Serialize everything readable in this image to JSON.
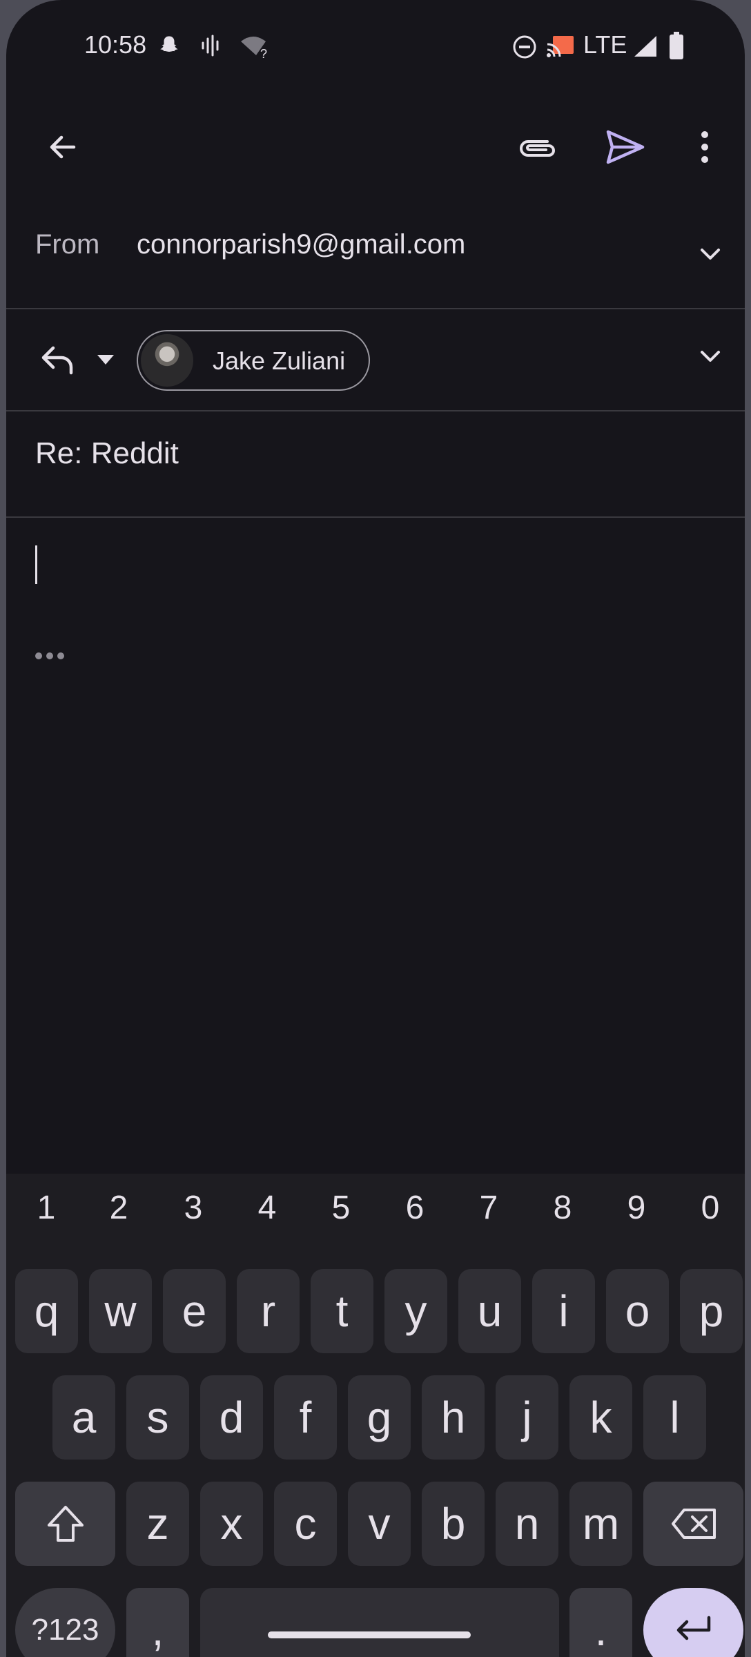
{
  "status_bar": {
    "time": "10:58",
    "network": "LTE",
    "icons": [
      "snapchat-icon",
      "voice-icon",
      "wifi-question-icon",
      "dnd-icon",
      "cast-icon",
      "signal-icon",
      "battery-icon"
    ]
  },
  "app_bar": {
    "icons": [
      "back-arrow-icon",
      "attach-icon",
      "send-icon",
      "more-vert-icon"
    ],
    "send_color": "#c0b1f2"
  },
  "compose": {
    "from_label": "From",
    "from_value": "connorparish9@gmail.com",
    "to_chip_name": "Jake Zuliani",
    "subject": "Re: Reddit"
  },
  "keyboard": {
    "numbers": [
      "1",
      "2",
      "3",
      "4",
      "5",
      "6",
      "7",
      "8",
      "9",
      "0"
    ],
    "row1": [
      "q",
      "w",
      "e",
      "r",
      "t",
      "y",
      "u",
      "i",
      "o",
      "p"
    ],
    "row2": [
      "a",
      "s",
      "d",
      "f",
      "g",
      "h",
      "j",
      "k",
      "l"
    ],
    "row3": [
      "z",
      "x",
      "c",
      "v",
      "b",
      "n",
      "m"
    ],
    "symbols_label": "?123",
    "comma": ",",
    "period": "."
  }
}
